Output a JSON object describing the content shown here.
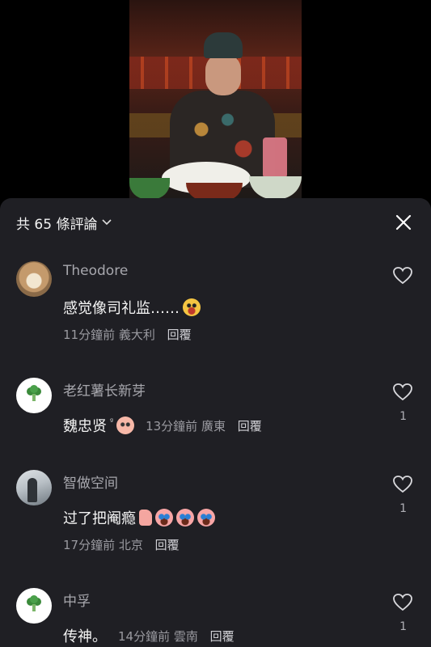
{
  "header": {
    "title": "共 65 條評論"
  },
  "comments": [
    {
      "name": "Theodore",
      "text": "感觉像司礼监……",
      "time": "11分鐘前",
      "location": "義大利",
      "reply": "回覆",
      "likes": ""
    },
    {
      "name": "老红薯长新芽",
      "text": "魏忠贤",
      "time": "13分鐘前",
      "location": "廣東",
      "reply": "回覆",
      "likes": "1"
    },
    {
      "name": "智做空间",
      "text": "过了把阉瘾",
      "time": "17分鐘前",
      "location": "北京",
      "reply": "回覆",
      "likes": "1"
    },
    {
      "name": "中孚",
      "text": "传神。",
      "time": "14分鐘前",
      "location": "雲南",
      "reply": "回覆",
      "likes": "1"
    }
  ],
  "icons": {
    "close": "close-icon",
    "heart": "heart-outline-icon",
    "dropdown": "chevron-down-icon"
  }
}
